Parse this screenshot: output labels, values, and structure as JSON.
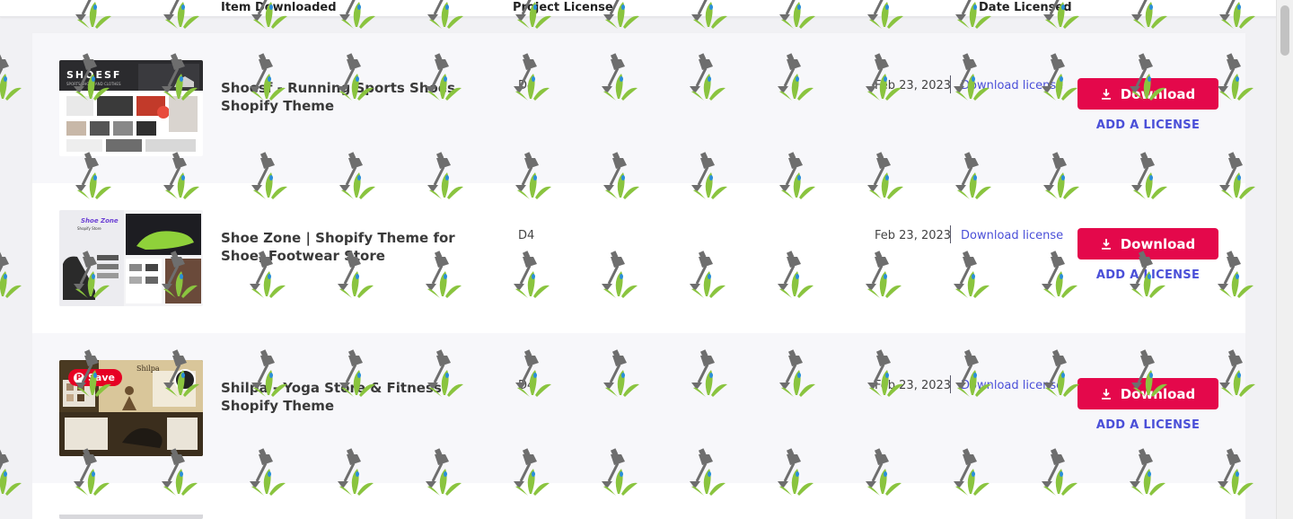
{
  "header": {
    "col_item": "Item Downloaded",
    "col_license": "Project License",
    "col_date": "Date Licensed"
  },
  "rows": [
    {
      "title": "Shoesf - Running Sports Shoes Shopify Theme",
      "license": "D4",
      "date": "Feb 23, 2023",
      "download_license": "Download license",
      "download": "Download",
      "add_license": "ADD A LICENSE",
      "thumb_brand": "SHOESF",
      "thumb_tagline": "SPORTS SHOES AND CLOTHES"
    },
    {
      "title": "Shoe Zone | Shopify Theme for Shoe, Footwear Store",
      "license": "D4",
      "date": "Feb 23, 2023",
      "download_license": "Download license",
      "download": "Download",
      "add_license": "ADD A LICENSE",
      "thumb_brand": "Shoe Zone",
      "thumb_tagline": "Shopify Store"
    },
    {
      "title": "Shilpa - Yoga Store & Fitness Shopify Theme",
      "license": "D4",
      "date": "Feb 23, 2023",
      "download_license": "Download license",
      "download": "Download",
      "add_license": "ADD A LICENSE",
      "thumb_brand": "Shilpa",
      "pinterest_save": "Save"
    }
  ],
  "colors": {
    "accent": "#e4084b",
    "link": "#4a4fd8",
    "row_alt": "#f7f7fa"
  }
}
